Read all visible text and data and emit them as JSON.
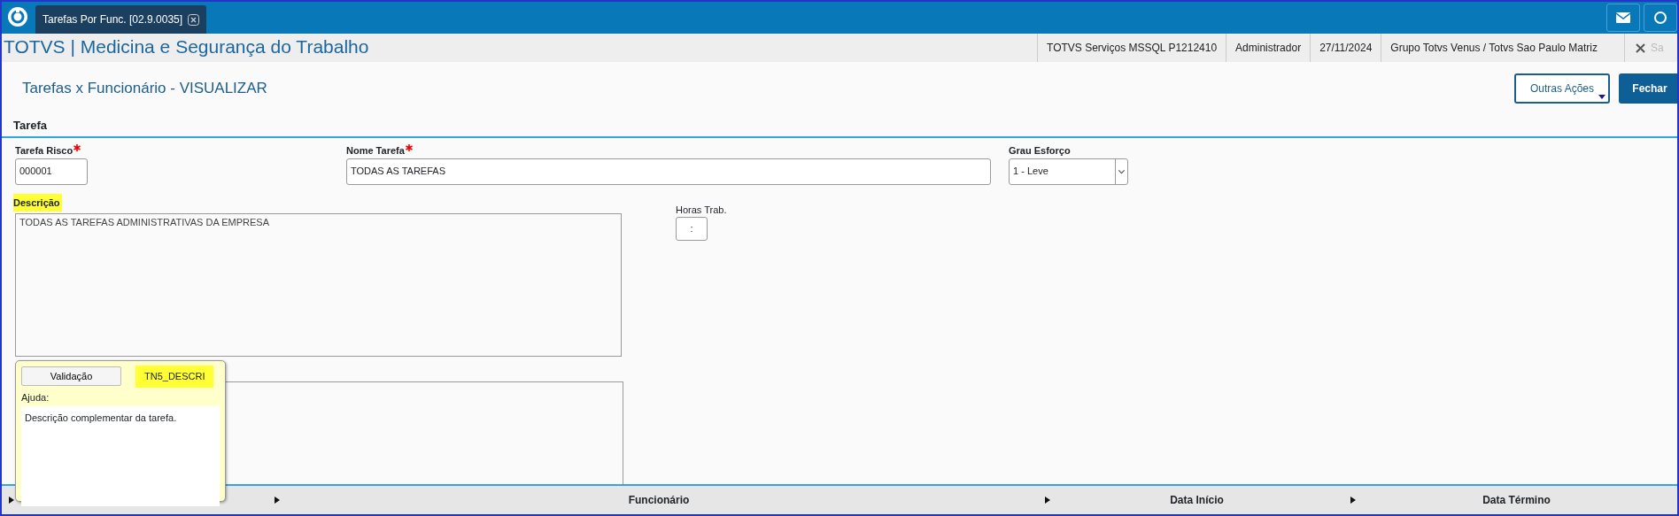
{
  "top_bar": {
    "tabs": [
      {
        "label": "Tarefas Por Func. [02.9.0035]",
        "selected": true
      }
    ]
  },
  "header": {
    "app_title": "TOTVS | Medicina e Segurança do Trabalho",
    "info": [
      "TOTVS Serviços MSSQL P1212410",
      "Administrador",
      "27/11/2024",
      "Grupo Totvs Venus / Totvs Sao Paulo Matriz"
    ],
    "close_label": "Sa"
  },
  "page": {
    "title": "Tarefas x Funcionário - VISUALIZAR",
    "actions": [
      {
        "label": "Outras Ações",
        "kind": "dropdown"
      },
      {
        "label": "Fechar",
        "kind": "primary"
      }
    ]
  },
  "section": {
    "title": "Tarefa"
  },
  "form_rows": [
    [
      {
        "kind": "input",
        "label": "Tarefa Risco",
        "required": true,
        "highlighted": false,
        "value": "000001"
      },
      {
        "kind": "input",
        "label": "Nome Tarefa",
        "required": true,
        "highlighted": false,
        "value": "TODAS AS TAREFAS"
      },
      {
        "kind": "select",
        "label": "Grau Esforço",
        "required": false,
        "highlighted": false,
        "value": "1 - Leve"
      }
    ],
    [
      {
        "kind": "textarea",
        "label": "Descrição",
        "required": false,
        "highlighted": true,
        "value": "TODAS AS TAREFAS ADMINISTRATIVAS DA EMPRESA"
      },
      {
        "kind": "input",
        "label": "Horas Trab.",
        "required": false,
        "highlighted": false,
        "value": ":"
      }
    ],
    [
      {
        "kind": "textarea"
      }
    ]
  ],
  "tooltip": {
    "button": "Validação",
    "field_id": "TN5_DESCRI",
    "field_id_highlighted": true,
    "help_label": "Ajuda:",
    "help_text": "Descrição complementar da tarefa."
  },
  "grid": {
    "columns": [
      {
        "kind": "column"
      },
      {
        "kind": "column",
        "label": "Funcionário"
      },
      {
        "kind": "column",
        "label": "Data Início"
      },
      {
        "kind": "column",
        "label": "Data Término"
      }
    ]
  }
}
